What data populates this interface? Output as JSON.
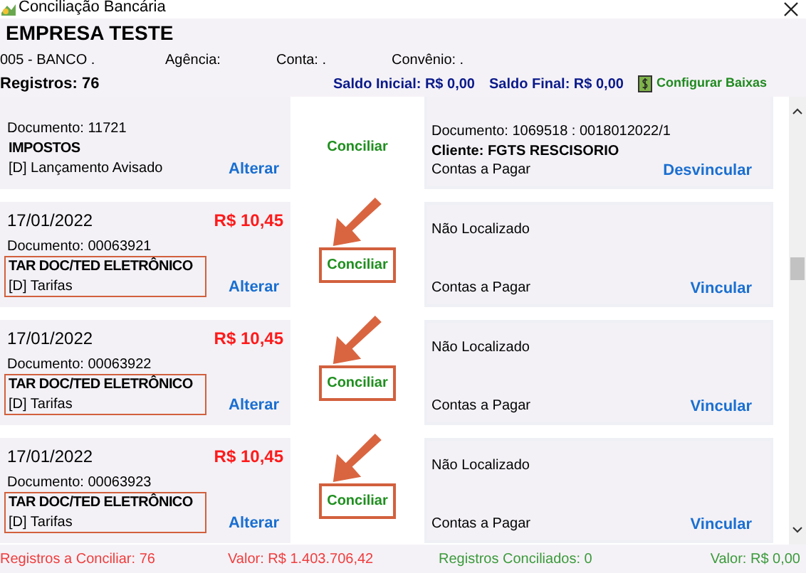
{
  "window": {
    "title": "Conciliação Bancária"
  },
  "header": {
    "company": "EMPRESA TESTE",
    "bank": "005 - BANCO .",
    "agencia": "Agência:",
    "conta": "Conta: .",
    "convenio": "Convênio: .",
    "registros": "Registros: 76",
    "saldo_inicial": "Saldo Inicial: R$ 0,00",
    "saldo_final": "Saldo Final: R$ 0,00",
    "configure_button": "Configurar Baixas"
  },
  "rows": [
    {
      "cut_top": true,
      "highlighted": false,
      "left": {
        "document": "Documento: 11721",
        "title": "IMPOSTOS",
        "category": "[D] Lançamento Avisado",
        "action": "Alterar"
      },
      "middle": "Conciliar",
      "right": {
        "document": "Documento: 1069518 : 0018012022/1",
        "client": "Cliente: FGTS RESCISORIO",
        "category": "Contas a Pagar",
        "action": "Desvincular"
      }
    },
    {
      "cut_top": false,
      "highlighted": true,
      "left": {
        "date": "17/01/2022",
        "amount": "R$ 10,45",
        "document": "Documento: 00063921",
        "title": "TAR DOC/TED ELETRÔNICO",
        "category": "[D] Tarifas",
        "action": "Alterar"
      },
      "middle": "Conciliar",
      "right": {
        "status": "Não Localizado",
        "category": "Contas a Pagar",
        "action": "Vincular"
      }
    },
    {
      "cut_top": false,
      "highlighted": true,
      "left": {
        "date": "17/01/2022",
        "amount": "R$ 10,45",
        "document": "Documento: 00063922",
        "title": "TAR DOC/TED ELETRÔNICO",
        "category": "[D] Tarifas",
        "action": "Alterar"
      },
      "middle": "Conciliar",
      "right": {
        "status": "Não Localizado",
        "category": "Contas a Pagar",
        "action": "Vincular"
      }
    },
    {
      "cut_top": false,
      "highlighted": true,
      "left": {
        "date": "17/01/2022",
        "amount": "R$ 10,45",
        "document": "Documento: 00063923",
        "title": "TAR DOC/TED ELETRÔNICO",
        "category": "[D] Tarifas",
        "action": "Alterar"
      },
      "middle": "Conciliar",
      "right": {
        "status": "Não Localizado",
        "category": "Contas a Pagar",
        "action": "Vincular"
      }
    }
  ],
  "footer": {
    "to_reconcile": "Registros a Conciliar: 76",
    "to_reconcile_value": "Valor: R$ 1.403.706,42",
    "reconciled": "Registros Conciliados: 0",
    "reconciled_value": "Valor: R$ 0,00"
  }
}
